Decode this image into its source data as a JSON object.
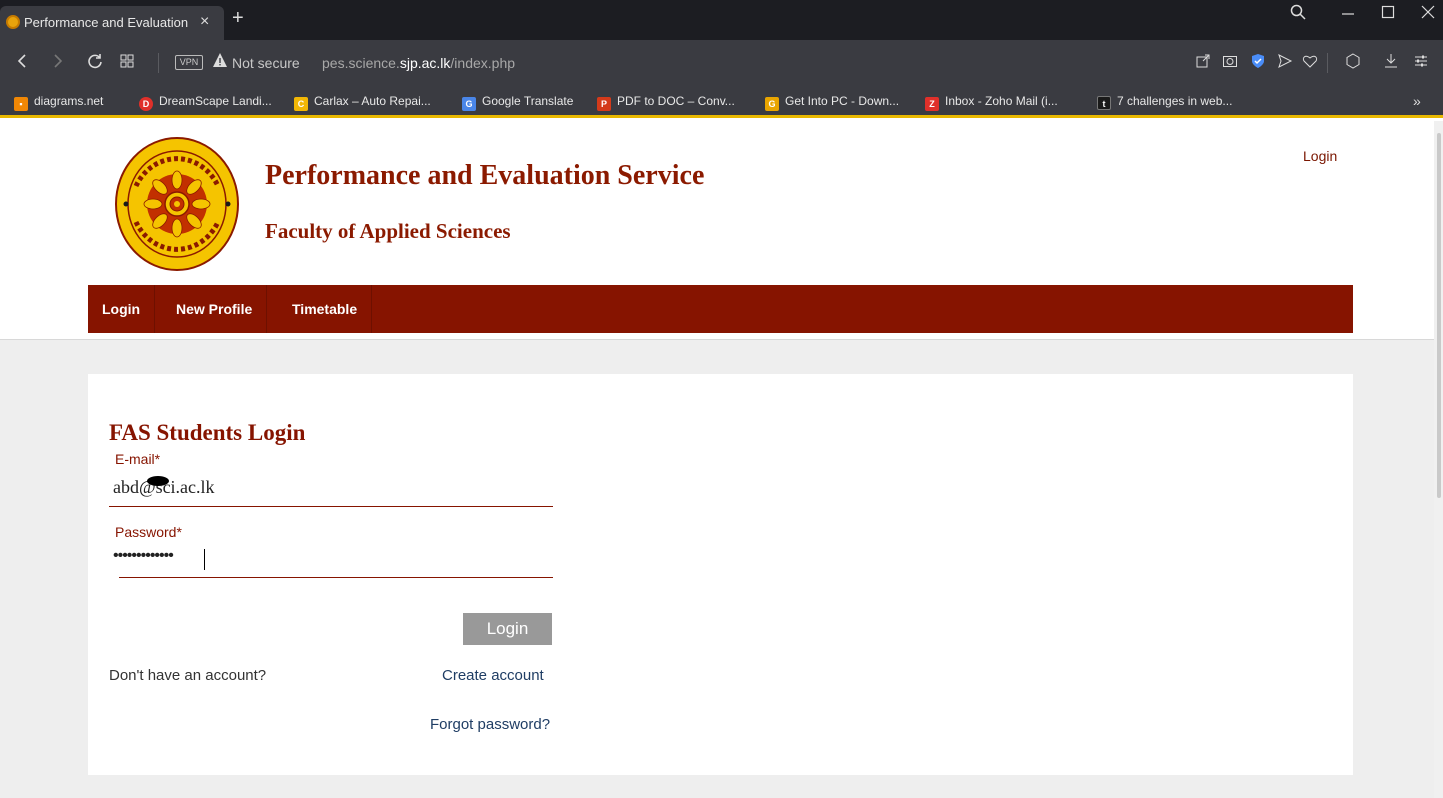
{
  "browser": {
    "tab_title": "Performance and Evaluation",
    "tab_close": "×",
    "new_tab": "+",
    "vpn_label": "VPN",
    "not_secure": "Not secure",
    "url_prefix": "pes.science.",
    "url_domain": "sjp.ac.lk",
    "url_path": "/index.php",
    "bookmarks": [
      {
        "label": "diagrams.net",
        "icon": "diagrams-icon",
        "color": "#f08705",
        "glyph": "▪"
      },
      {
        "label": "DreamScape Landi...",
        "icon": "dreamscape-icon",
        "color": "#e0302a",
        "glyph": "D"
      },
      {
        "label": "Carlax – Auto Repai...",
        "icon": "carlax-icon",
        "color": "#f2b705",
        "glyph": "C"
      },
      {
        "label": "Google Translate",
        "icon": "google-translate-icon",
        "color": "#4a86e8",
        "glyph": "G"
      },
      {
        "label": "PDF to DOC – Conv...",
        "icon": "pdf-to-doc-icon",
        "color": "#d43a1a",
        "glyph": "P"
      },
      {
        "label": "Get Into PC - Down...",
        "icon": "getintopc-icon",
        "color": "#e9a500",
        "glyph": "G"
      },
      {
        "label": "Inbox - Zoho Mail (i...",
        "icon": "zoho-icon",
        "color": "#e0302a",
        "glyph": "Z"
      },
      {
        "label": "7 challenges in web...",
        "icon": "tumblr-icon",
        "color": "#1a1a1a",
        "glyph": "t"
      }
    ],
    "bookmarks_more": "»"
  },
  "header": {
    "title": "Performance and Evaluation Service",
    "subtitle": "Faculty of Applied Sciences",
    "top_login": "Login"
  },
  "menu": [
    {
      "label": "Login"
    },
    {
      "label": "New Profile"
    },
    {
      "label": "Timetable"
    }
  ],
  "login_form": {
    "title": "FAS Students Login",
    "email_label": "E-mail*",
    "email_value": "abd@sci.ac.lk",
    "password_label": "Password*",
    "password_value": "•••••••••••••",
    "submit_label": "Login",
    "no_account_text": "Don't have an account?",
    "create_account": "Create account",
    "forgot_password": "Forgot password?"
  },
  "colors": {
    "brand": "#861400",
    "link": "#1f3d64",
    "button_disabled": "#999999",
    "page_bg": "#eeeeee"
  }
}
